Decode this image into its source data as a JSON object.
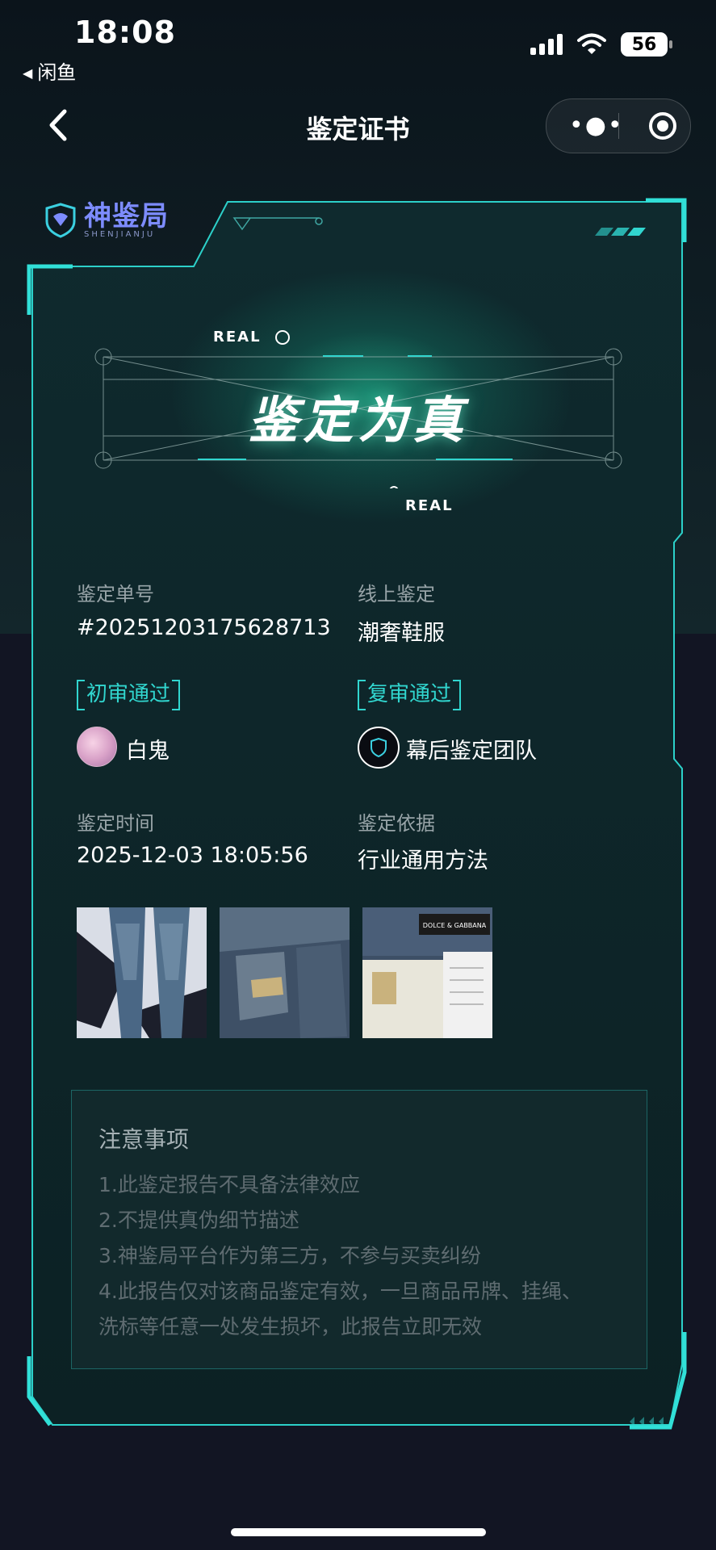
{
  "status_bar": {
    "time": "18:08",
    "back_app": "闲鱼",
    "battery": "56"
  },
  "nav": {
    "title": "鉴定证书"
  },
  "logo": {
    "name": "神鉴局",
    "subtitle": "SHENJIANJU"
  },
  "hero": {
    "badge_top": "REAL",
    "badge_bottom": "REAL",
    "title": "鉴定为真"
  },
  "info": {
    "order_label": "鉴定单号",
    "order_value": "#20251203175628713",
    "channel_label": "线上鉴定",
    "channel_value": "潮奢鞋服",
    "first_review_tag": "初审通过",
    "first_reviewer": "白鬼",
    "second_review_tag": "复审通过",
    "second_reviewer": "幕后鉴定团队",
    "time_label": "鉴定时间",
    "time_value": "2025-12-03 18:05:56",
    "basis_label": "鉴定依据",
    "basis_value": "行业通用方法"
  },
  "photos": {
    "items": [
      "jeans-front",
      "jeans-back-label",
      "brand-label"
    ],
    "brand_text": "DOLCE & GABBANA"
  },
  "notice": {
    "title": "注意事项",
    "lines": [
      "1.此鉴定报告不具备法律效应",
      "2.不提供真伪细节描述",
      "3.神鉴局平台作为第三方，不参与买卖纠纷",
      "4.此报告仅对该商品鉴定有效，一旦商品吊牌、挂绳、",
      "洗标等任意一处发生损坏，此报告立即无效"
    ]
  },
  "colors": {
    "accent": "#31d6cf",
    "card_bg": "#0e2a2c",
    "page_bg": "#121523"
  }
}
